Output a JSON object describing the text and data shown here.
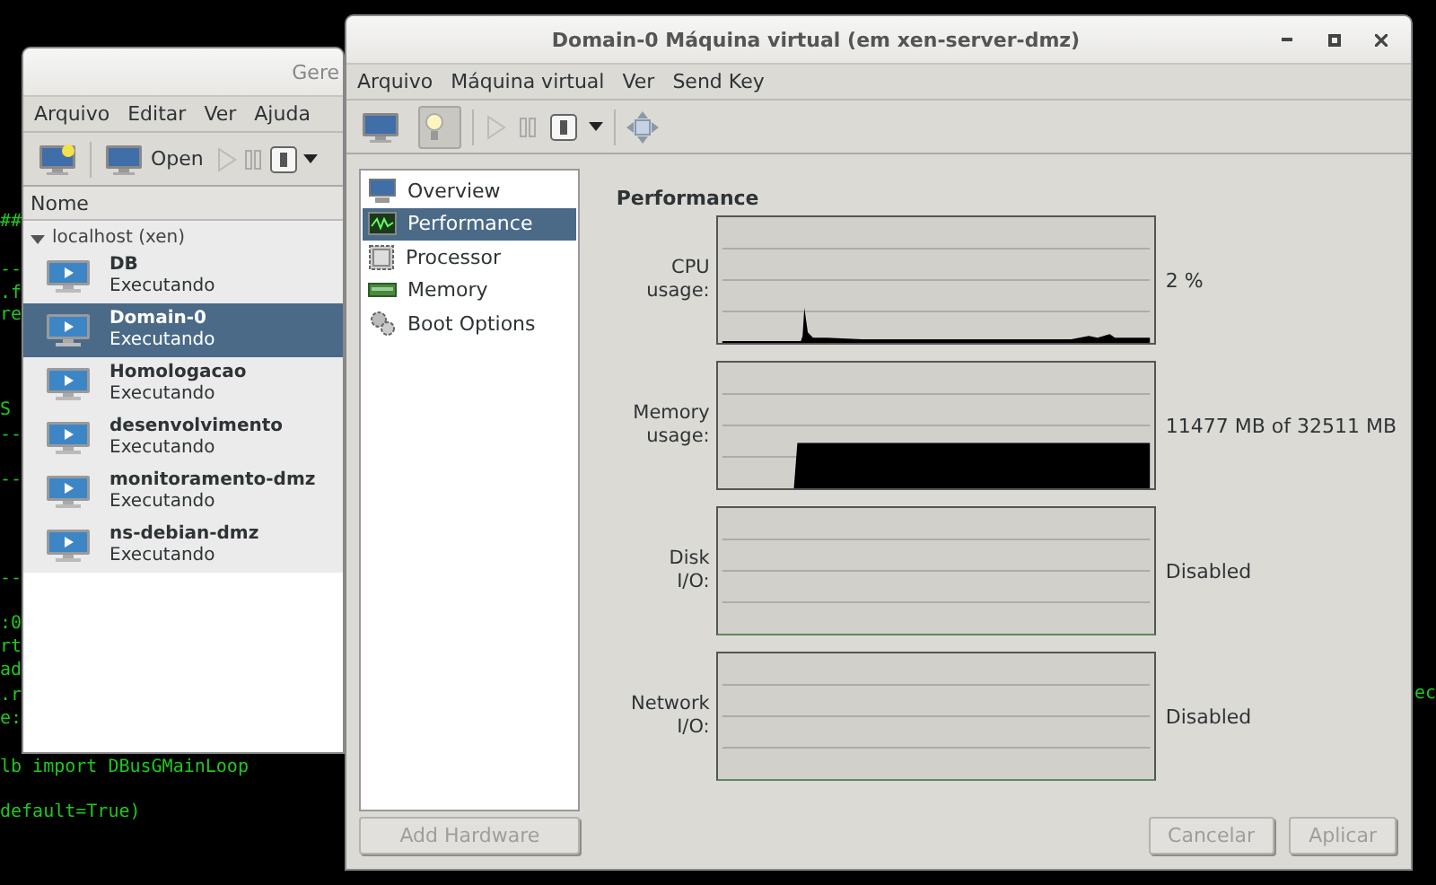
{
  "terminal": {
    "lines": [
      "##",
      "--",
      ".f",
      "re",
      "S",
      "--",
      "--",
      "--",
      ":0",
      "rt",
      "ad",
      ".r",
      "e:",
      "lb import DBusGMainLoop",
      "default=True)"
    ],
    "right_fragment": "ec"
  },
  "manager_window": {
    "title": "Gere",
    "menu": [
      "Arquivo",
      "Editar",
      "Ver",
      "Ajuda"
    ],
    "open_label": "Open",
    "column": "Nome",
    "host": {
      "label": "localhost (xen)",
      "expanded": true,
      "vms": [
        {
          "name": "DB",
          "status": "Executando",
          "selected": false
        },
        {
          "name": "Domain-0",
          "status": "Executando",
          "selected": true
        },
        {
          "name": "Homologacao",
          "status": "Executando",
          "selected": false
        },
        {
          "name": "desenvolvimento",
          "status": "Executando",
          "selected": false
        },
        {
          "name": "monitoramento-dmz",
          "status": "Executando",
          "selected": false
        },
        {
          "name": "ns-debian-dmz",
          "status": "Executando",
          "selected": false
        }
      ]
    }
  },
  "details_window": {
    "title": "Domain-0 Máquina virtual (em xen-server-dmz)",
    "menu": [
      "Arquivo",
      "Máquina virtual",
      "Ver",
      "Send Key"
    ],
    "toolbar": [
      {
        "kind": "console",
        "selected": false
      },
      {
        "kind": "details",
        "selected": true
      }
    ],
    "nav": [
      {
        "label": "Overview",
        "kind": "overview",
        "selected": false
      },
      {
        "label": "Performance",
        "kind": "performance",
        "selected": true
      },
      {
        "label": "Processor",
        "kind": "processor",
        "selected": false
      },
      {
        "label": "Memory",
        "kind": "memory",
        "selected": false
      },
      {
        "label": "Boot Options",
        "kind": "boot",
        "selected": false
      }
    ],
    "add_hardware": {
      "label": "Add Hardware",
      "disabled": true
    },
    "section_title": "Performance",
    "metrics": [
      {
        "label": "CPU usage:",
        "kind": "cpu",
        "reading": "2 %"
      },
      {
        "label": "Memory usage:",
        "kind": "memory",
        "reading": "11477 MB of 32511 MB"
      },
      {
        "label": "Disk I/O:",
        "kind": "disabled",
        "reading": "Disabled"
      },
      {
        "label": "Network I/O:",
        "kind": "disabled",
        "reading": "Disabled"
      }
    ],
    "buttons": [
      {
        "label": "Cancelar",
        "disabled": true
      },
      {
        "label": "Aplicar",
        "disabled": true
      }
    ]
  }
}
